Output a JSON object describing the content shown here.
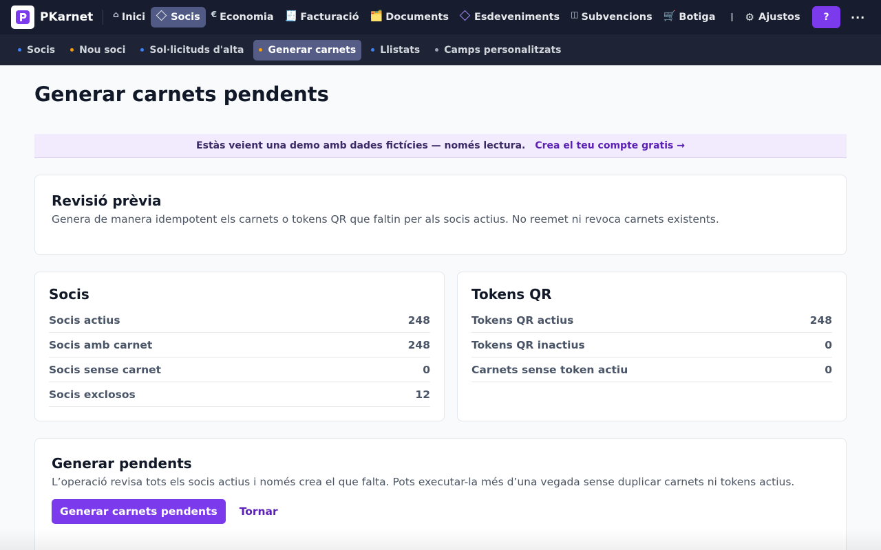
{
  "app": {
    "name": "PKarnet"
  },
  "colors": {
    "accent": "#7c3aed",
    "topbar_bg": "#171c2e",
    "subnav_bg": "#1e2336",
    "dot_blue": "#3b82f6",
    "dot_orange": "#f59e0b",
    "dot_gray": "#9ca3af"
  },
  "topnav": {
    "items": [
      {
        "label": "Inici",
        "icon": "home-icon"
      },
      {
        "label": "Socis",
        "icon": "diamond-icon",
        "active": true
      },
      {
        "label": "Economia",
        "icon": "euro-icon"
      },
      {
        "label": "Facturació",
        "icon": "receipt-icon"
      },
      {
        "label": "Documents",
        "icon": "folder-icon"
      },
      {
        "label": "Esdeveniments",
        "icon": "diamond-purple-icon"
      },
      {
        "label": "Subvencions",
        "icon": "columns-icon"
      },
      {
        "label": "Botiga",
        "icon": "cart-icon"
      }
    ],
    "settings_label": "Ajustos",
    "help_label": "?",
    "more_label": "..."
  },
  "subnav": {
    "items": [
      {
        "label": "Socis",
        "dot": "blue"
      },
      {
        "label": "Nou soci",
        "dot": "orange"
      },
      {
        "label": "Sol·licituds d'alta",
        "dot": "blue"
      },
      {
        "label": "Generar carnets",
        "dot": "orange",
        "active": true
      },
      {
        "label": "Llistats",
        "dot": "blue"
      },
      {
        "label": "Camps personalitzats",
        "dot": "gray"
      }
    ]
  },
  "page": {
    "title": "Generar carnets pendents"
  },
  "banner": {
    "message": "Estàs veient una demo amb dades fictícies — només lectura.",
    "cta": "Crea el teu compte gratis →"
  },
  "preview": {
    "title": "Revisió prèvia",
    "description": "Genera de manera idempotent els carnets o tokens QR que faltin per als socis actius. No reemet ni revoca carnets existents."
  },
  "members_stats": {
    "title": "Socis",
    "rows": [
      {
        "label": "Socis actius",
        "value": "248"
      },
      {
        "label": "Socis amb carnet",
        "value": "248"
      },
      {
        "label": "Socis sense carnet",
        "value": "0"
      },
      {
        "label": "Socis exclosos",
        "value": "12"
      }
    ]
  },
  "qr_stats": {
    "title": "Tokens QR",
    "rows": [
      {
        "label": "Tokens QR actius",
        "value": "248"
      },
      {
        "label": "Tokens QR inactius",
        "value": "0"
      },
      {
        "label": "Carnets sense token actiu",
        "value": "0"
      }
    ]
  },
  "generate": {
    "title": "Generar pendents",
    "description": "L’operació revisa tots els socis actius i només crea el que falta. Pots executar-la més d’una vegada sense duplicar carnets ni tokens actius.",
    "primary_label": "Generar carnets pendents",
    "back_label": "Tornar"
  }
}
